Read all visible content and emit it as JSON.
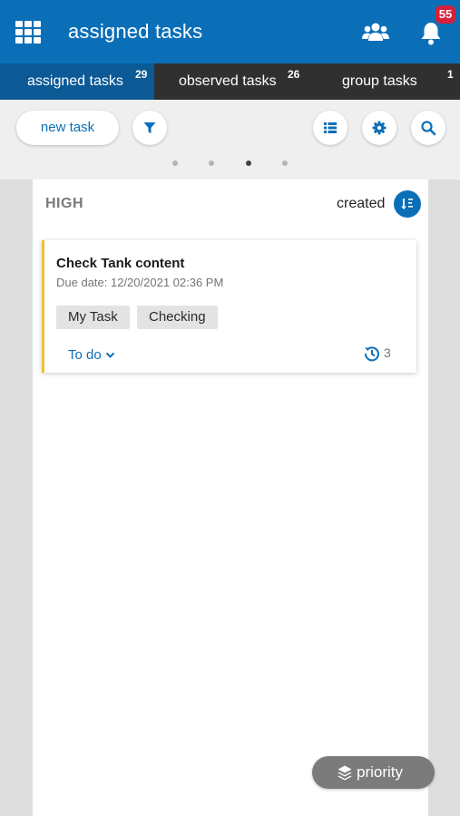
{
  "header": {
    "title": "assigned tasks",
    "notification_count": "55",
    "icons": [
      "apps-grid-icon",
      "users-icon",
      "bell-icon"
    ],
    "bg_color": "#0b6fb8"
  },
  "tabs": [
    {
      "label": "assigned tasks",
      "count": "29",
      "active": true
    },
    {
      "label": "observed tasks",
      "count": "26",
      "active": false
    },
    {
      "label": "group tasks",
      "count": "1",
      "active": false
    }
  ],
  "toolbar": {
    "new_task_label": "new task",
    "icons": [
      "filter-icon",
      "list-view-icon",
      "settings-icon",
      "search-icon"
    ]
  },
  "pager": {
    "total": 4,
    "active_index": 2
  },
  "column": {
    "title": "HIGH",
    "sort_label": "created",
    "sort_icon": "sort-icon"
  },
  "card": {
    "title": "Check Tank content",
    "due": "Due date: 12/20/2021 02:36 PM",
    "tags": [
      "My Task",
      "Checking"
    ],
    "status": "To do",
    "history_count": "3",
    "accent_color": "#f2c037"
  },
  "floating": {
    "priority_label": "priority",
    "icon": "layers-icon"
  }
}
